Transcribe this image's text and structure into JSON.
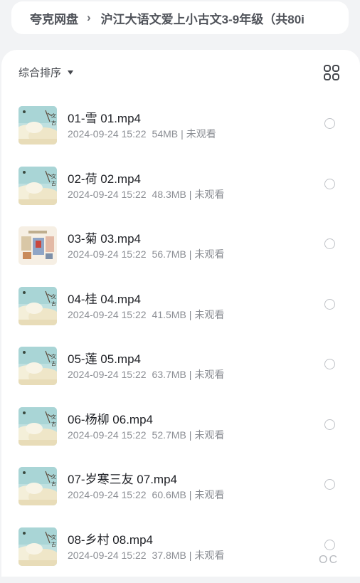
{
  "breadcrumb": {
    "root": "夸克网盘",
    "separator": "›",
    "current": "沪江大语文爱上小古文3-9年级（共80i"
  },
  "toolbar": {
    "sort_label": "综合排序",
    "sort_icon": "caret-down-icon",
    "view_icon": "grid-view-icon"
  },
  "files": [
    {
      "name": "01-雪 01.mp4",
      "date": "2024-09-24 15:22",
      "size": "54MB",
      "status": "未观看",
      "thumb": "landscape"
    },
    {
      "name": "02-荷 02.mp4",
      "date": "2024-09-24 15:22",
      "size": "48.3MB",
      "status": "未观看",
      "thumb": "landscape"
    },
    {
      "name": "03-菊 03.mp4",
      "date": "2024-09-24 15:22",
      "size": "56.7MB",
      "status": "未观看",
      "thumb": "illustration"
    },
    {
      "name": "04-桂 04.mp4",
      "date": "2024-09-24 15:22",
      "size": "41.5MB",
      "status": "未观看",
      "thumb": "landscape"
    },
    {
      "name": "05-莲 05.mp4",
      "date": "2024-09-24 15:22",
      "size": "63.7MB",
      "status": "未观看",
      "thumb": "landscape"
    },
    {
      "name": "06-杨柳 06.mp4",
      "date": "2024-09-24 15:22",
      "size": "52.7MB",
      "status": "未观看",
      "thumb": "landscape"
    },
    {
      "name": "07-岁寒三友 07.mp4",
      "date": "2024-09-24 15:22",
      "size": "60.6MB",
      "status": "未观看",
      "thumb": "landscape"
    },
    {
      "name": "08-乡村 08.mp4",
      "date": "2024-09-24 15:22",
      "size": "37.8MB",
      "status": "未观看",
      "thumb": "landscape"
    }
  ],
  "corner_mark": "OC",
  "colors": {
    "background": "#f2f3f5",
    "panel": "#ffffff",
    "text": "#1d1f24",
    "meta": "#8a8d93"
  }
}
